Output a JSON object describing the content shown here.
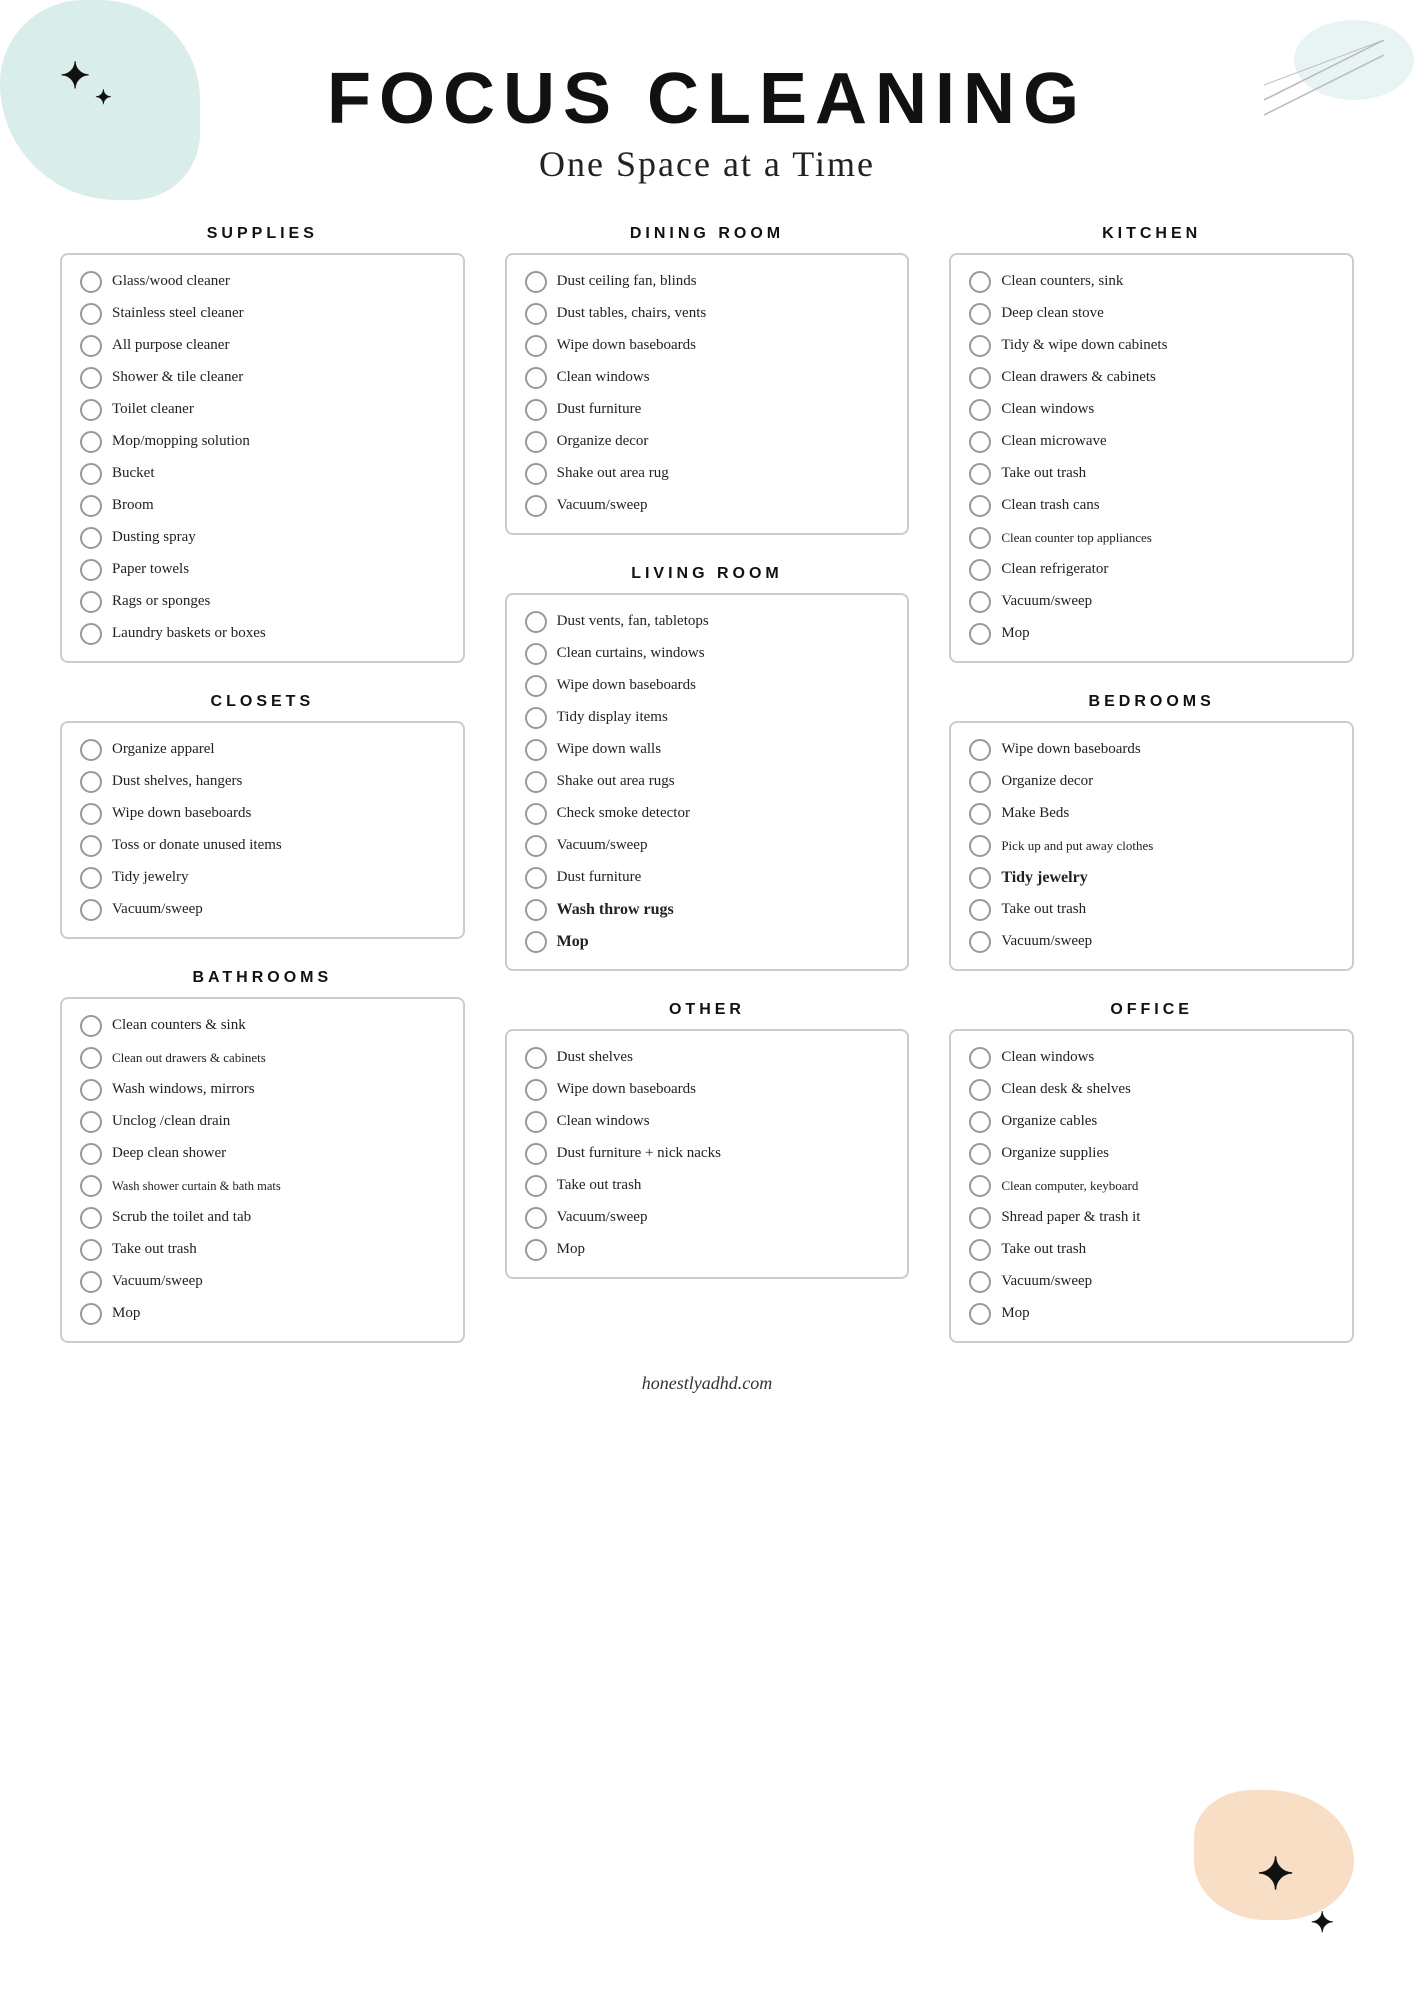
{
  "header": {
    "main_title": "FOCUS CLEANING",
    "sub_title": "One Space at a Time"
  },
  "footer": {
    "url": "honestlyadhd.com"
  },
  "sections": {
    "supplies": {
      "title": "SUPPLIES",
      "items": [
        "Glass/wood cleaner",
        "Stainless steel cleaner",
        "All purpose cleaner",
        "Shower & tile cleaner",
        "Toilet cleaner",
        "Mop/mopping solution",
        "Bucket",
        "Broom",
        "Dusting spray",
        "Paper towels",
        "Rags or sponges",
        "Laundry baskets or boxes"
      ]
    },
    "dining_room": {
      "title": "DINING ROOM",
      "items": [
        "Dust ceiling fan, blinds",
        "Dust tables, chairs, vents",
        "Wipe down baseboards",
        "Clean windows",
        "Dust furniture",
        "Organize decor",
        "Shake out area rug",
        "Vacuum/sweep"
      ]
    },
    "kitchen": {
      "title": "KITCHEN",
      "items": [
        "Clean counters, sink",
        "Deep clean stove",
        "Tidy & wipe down cabinets",
        "Clean drawers & cabinets",
        "Clean windows",
        "Clean microwave",
        "Take out trash",
        "Clean trash cans",
        "Clean counter top appliances",
        "Clean refrigerator",
        "Vacuum/sweep",
        "Mop"
      ]
    },
    "closets": {
      "title": "CLOSETS",
      "items": [
        "Organize apparel",
        "Dust shelves, hangers",
        "Wipe down baseboards",
        "Toss or donate unused items",
        "Tidy jewelry",
        "Vacuum/sweep"
      ]
    },
    "living_room": {
      "title": "LIVING ROOM",
      "items": [
        "Dust vents, fan, tabletops",
        "Clean curtains, windows",
        "Wipe down baseboards",
        "Tidy display items",
        "Wipe down walls",
        "Shake out area rugs",
        "Check smoke detector",
        "Vacuum/sweep",
        "Dust furniture",
        "Wash throw rugs",
        "Mop"
      ],
      "bold_items": [
        "Wash throw rugs",
        "Mop"
      ]
    },
    "bedrooms": {
      "title": "BEDROOMS",
      "items": [
        "Wipe down baseboards",
        "Organize decor",
        "Make Beds",
        "Pick up and put away clothes",
        "Tidy jewelry",
        "Take out trash",
        "Vacuum/sweep"
      ],
      "bold_items": [
        "Tidy jewelry"
      ]
    },
    "bathrooms": {
      "title": "BATHROOMS",
      "items": [
        "Clean counters & sink",
        "Clean out drawers & cabinets",
        "Wash windows, mirrors",
        "Unclog /clean drain",
        "Deep clean shower",
        "Wash shower curtain & bath mats",
        "Scrub the toilet and tab",
        "Take out trash",
        "Vacuum/sweep",
        "Mop"
      ]
    },
    "other": {
      "title": "OTHER",
      "items": [
        "Dust shelves",
        "Wipe down baseboards",
        "Clean windows",
        "Dust furniture + nick nacks",
        "Take out trash",
        "Vacuum/sweep",
        "Mop"
      ]
    },
    "office": {
      "title": "OFFICE",
      "items": [
        "Clean windows",
        "Clean desk & shelves",
        "Organize cables",
        "Organize supplies",
        "Clean computer, keyboard",
        "Shread paper & trash it",
        "Take out trash",
        "Vacuum/sweep",
        "Mop"
      ]
    }
  }
}
